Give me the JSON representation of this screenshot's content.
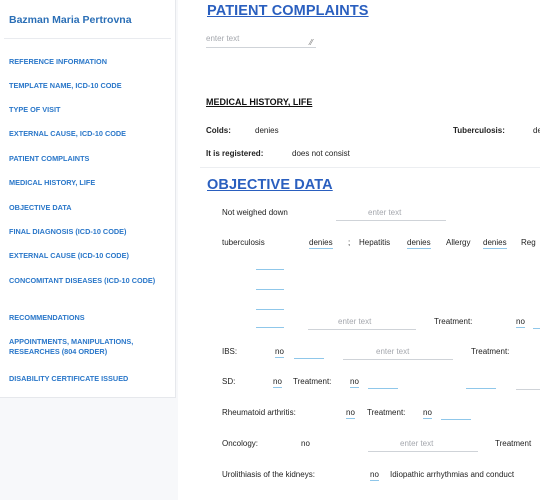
{
  "sidebar": {
    "patient_name": "Bazman Maria Pertrovna",
    "items": [
      {
        "label": "REFERENCE INFORMATION"
      },
      {
        "label": "TEMPLATE NAME, ICD-10 CODE"
      },
      {
        "label": "TYPE OF VISIT"
      },
      {
        "label": "EXTERNAL CAUSE, ICD-10 CODE"
      },
      {
        "label": "PATIENT COMPLAINTS"
      },
      {
        "label": "MEDICAL HISTORY, LIFE"
      },
      {
        "label": "OBJECTIVE DATA"
      },
      {
        "label": "FINAL DIAGNOSIS (ICD-10 CODE)"
      },
      {
        "label": "EXTERNAL CAUSE (ICD-10 CODE)"
      },
      {
        "label": "CONCOMITANT DISEASES (ICD-10 CODE)"
      },
      {
        "label": "RECOMMENDATIONS"
      },
      {
        "label": "APPOINTMENTS, MANIPULATIONS, RESEARCHES (804 ORDER)"
      },
      {
        "label": "DISABILITY CERTIFICATE ISSUED"
      }
    ]
  },
  "complaints": {
    "title": "PATIENT COMPLAINTS",
    "placeholder": "enter text"
  },
  "history": {
    "title": "MEDICAL HISTORY, LIFE",
    "colds_label": "Colds:",
    "colds_value": "denies",
    "tuberculosis_label": "Tuberculosis:",
    "tuberculosis_value": "de",
    "registered_label": "It is registered:",
    "registered_value": "does not consist"
  },
  "objective": {
    "title": "OBJECTIVE DATA",
    "not_weighed_label": "Not weighed down",
    "enter_text": "enter text",
    "tuberculosis_label": "tuberculosis",
    "tb_value": "denies",
    "semicolon": ";",
    "hepatitis_label": "Hepatitis",
    "hepatitis_value": "denies",
    "allergy_label": "Allergy",
    "allergy_value": "denies",
    "reg_label": "Reg",
    "treatment_label": "Treatment:",
    "no": "no",
    "ibs_label": "IBS:",
    "sd_label": "SD:",
    "ra_label": "Rheumatoid arthritis:",
    "oncology_label": "Oncology:",
    "treatment_cut": "Treatment",
    "urolithiasis_label": "Urolithiasis of the kidneys:",
    "arrhythmias_label": "Idiopathic arrhythmias and conduct"
  }
}
